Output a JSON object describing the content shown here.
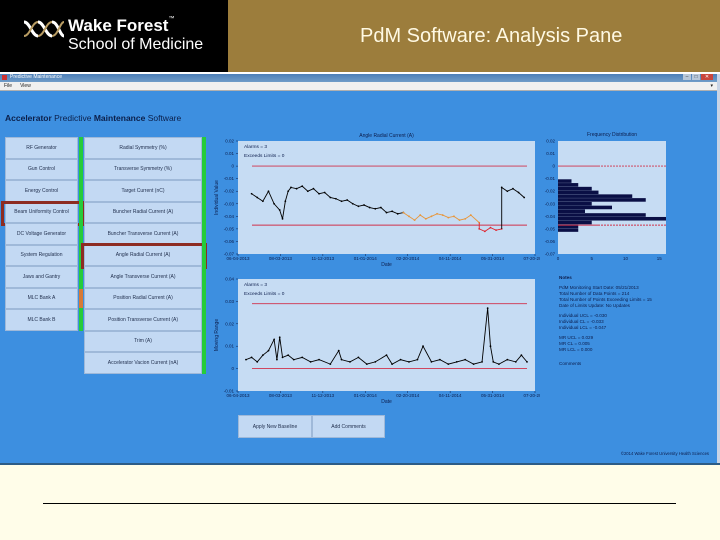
{
  "slide": {
    "logo_line1": "Wake Forest",
    "logo_tm": "™",
    "logo_line2": "School of Medicine",
    "title": "PdM Software: Analysis Pane"
  },
  "window": {
    "title": "Predictive Maintenance",
    "controls": [
      "–",
      "□",
      "✕"
    ],
    "menu": [
      "File",
      "View"
    ],
    "menu_right_icon": "dropdown-icon"
  },
  "app": {
    "heading_bold1": "Accelerator",
    "heading_normal1": " Predictive ",
    "heading_bold2": "Maintenance",
    "heading_normal2": " Software"
  },
  "systems": [
    {
      "label": "RF Generator",
      "selected": false
    },
    {
      "label": "Gun Control",
      "selected": false
    },
    {
      "label": "Energy Control",
      "selected": false
    },
    {
      "label": "Beam Uniformity Control",
      "selected": true
    },
    {
      "label": "DC Voltage Generator",
      "selected": false
    },
    {
      "label": "System Regulation",
      "selected": false
    },
    {
      "label": "Jaws and Gantry",
      "selected": false
    },
    {
      "label": "MLC Bank A",
      "selected": false
    },
    {
      "label": "MLC Bank B",
      "selected": false
    }
  ],
  "parameters": [
    {
      "label": "Radial Symmetry (%)",
      "selected": false
    },
    {
      "label": "Transverse Symmetry (%)",
      "selected": false
    },
    {
      "label": "Target Current (nC)",
      "selected": false
    },
    {
      "label": "Buncher Radial Current (A)",
      "selected": false
    },
    {
      "label": "Buncher Transverse Current (A)",
      "selected": false
    },
    {
      "label": "Angle Radial Current (A)",
      "selected": true
    },
    {
      "label": "Angle Transverse Current (A)",
      "selected": false
    },
    {
      "label": "Position Radial Current (A)",
      "selected": false
    },
    {
      "label": "Position Transverse Current (A)",
      "selected": false
    },
    {
      "label": "Trim (A)",
      "selected": false
    },
    {
      "label": "Accelerator Vacion Current (nA)",
      "selected": false
    }
  ],
  "colors": {
    "app_bg": "#3d8fe0",
    "panel_bg": "#c3d9f3",
    "status_green": "#25cc3a",
    "status_orange": "#d77a36",
    "highlight_red": "#8d2c22",
    "limit_line": "#d0304a",
    "warn_orange": "#e8963a",
    "alarm_red": "#e0202a",
    "hist_bar": "#0a0f45"
  },
  "chart_data": [
    {
      "type": "line",
      "title": "Angle Radial Current (A)",
      "xlabel": "Date",
      "ylabel": "Individual Value",
      "ylim": [
        -0.07,
        0.02
      ],
      "yticks": [
        "0.02",
        "0.01",
        "0",
        "-0.01",
        "-0.02",
        "-0.03",
        "-0.04",
        "-0.05",
        "-0.06",
        "-0.07"
      ],
      "xticks": [
        "06-04-2013",
        "08-03-2013",
        "11-12-2013",
        "01-01-2014",
        "02-20-2014",
        "04-11-2014",
        "05-31-2014",
        "07-20-2014"
      ],
      "annotations": [
        "Alarms = 3",
        "Exceeds Limits = 0"
      ],
      "limits": {
        "ucl": 0.0,
        "lcl": -0.047
      },
      "series": [
        {
          "name": "normal",
          "color": "#000000",
          "x": [
            0.02,
            0.04,
            0.06,
            0.08,
            0.1,
            0.12,
            0.13,
            0.14,
            0.15,
            0.16,
            0.18,
            0.2,
            0.22,
            0.24,
            0.26,
            0.28,
            0.3,
            0.32,
            0.34,
            0.36,
            0.38,
            0.4,
            0.42,
            0.44,
            0.46,
            0.48,
            0.5,
            0.52,
            0.54,
            0.56
          ],
          "values": [
            -0.022,
            -0.025,
            -0.028,
            -0.02,
            -0.03,
            -0.035,
            -0.042,
            -0.028,
            -0.02,
            -0.017,
            -0.018,
            -0.016,
            -0.02,
            -0.018,
            -0.022,
            -0.021,
            -0.025,
            -0.026,
            -0.028,
            -0.027,
            -0.03,
            -0.032,
            -0.031,
            -0.033,
            -0.034,
            -0.033,
            -0.037,
            -0.036,
            -0.038,
            -0.037
          ]
        },
        {
          "name": "warning",
          "color": "#e8963a",
          "x": [
            0.56,
            0.58,
            0.6,
            0.62,
            0.64,
            0.66,
            0.68,
            0.7,
            0.72,
            0.74,
            0.76,
            0.78,
            0.8,
            0.83
          ],
          "values": [
            -0.037,
            -0.04,
            -0.043,
            -0.039,
            -0.042,
            -0.04,
            -0.038,
            -0.039,
            -0.041,
            -0.04,
            -0.043,
            -0.042,
            -0.039,
            -0.045
          ]
        },
        {
          "name": "alarm",
          "color": "#e0202a",
          "x": [
            0.83,
            0.85,
            0.87,
            0.89,
            0.91
          ],
          "values": [
            -0.05,
            -0.052,
            -0.049,
            -0.051,
            -0.05
          ]
        },
        {
          "name": "recovered",
          "color": "#000000",
          "x": [
            0.91,
            0.93,
            0.95,
            0.97,
            0.99
          ],
          "values": [
            -0.017,
            -0.02,
            -0.018,
            -0.021,
            -0.025
          ]
        }
      ]
    },
    {
      "type": "bar",
      "orientation": "horizontal",
      "title": "Frequency Distribution",
      "ylim": [
        -0.07,
        0.02
      ],
      "xlim": [
        0,
        16
      ],
      "xticks": [
        "0",
        "5",
        "10",
        "15"
      ],
      "yticks": [
        "0.02",
        "0.01",
        "0",
        "-0.01",
        "-0.02",
        "-0.03",
        "-0.04",
        "-0.05",
        "-0.06",
        "-0.07"
      ],
      "bins": [
        -0.012,
        -0.015,
        -0.018,
        -0.021,
        -0.024,
        -0.027,
        -0.03,
        -0.033,
        -0.036,
        -0.039,
        -0.042,
        -0.045,
        -0.048,
        -0.051
      ],
      "values": [
        2,
        3,
        5,
        6,
        11,
        13,
        5,
        8,
        4,
        13,
        16,
        5,
        3,
        3
      ]
    },
    {
      "type": "line",
      "title": "",
      "xlabel": "Date",
      "ylabel": "Moving Range",
      "ylim": [
        -0.01,
        0.04
      ],
      "yticks": [
        "0.04",
        "0.03",
        "0.02",
        "0.01",
        "0",
        "-0.01"
      ],
      "xticks": [
        "06-04-2013",
        "08-03-2013",
        "11-12-2013",
        "01-01-2014",
        "02-20-2014",
        "04-11-2014",
        "05-31-2014",
        "07-20-2014"
      ],
      "annotations": [
        "Alarms = 3",
        "Exceeds Limits = 0"
      ],
      "limits": {
        "ucl": 0.029,
        "lcl": 0.0
      },
      "series": [
        {
          "name": "moving-range",
          "color": "#000000",
          "x": [
            0.0,
            0.02,
            0.04,
            0.06,
            0.08,
            0.1,
            0.11,
            0.12,
            0.13,
            0.15,
            0.17,
            0.2,
            0.23,
            0.26,
            0.3,
            0.33,
            0.34,
            0.37,
            0.4,
            0.43,
            0.46,
            0.5,
            0.52,
            0.55,
            0.58,
            0.61,
            0.63,
            0.66,
            0.69,
            0.72,
            0.75,
            0.78,
            0.81,
            0.84,
            0.86,
            0.87,
            0.88,
            0.9,
            0.93,
            0.96,
            0.98,
            1.0
          ],
          "values": [
            0.004,
            0.005,
            0.003,
            0.006,
            0.008,
            0.013,
            0.004,
            0.014,
            0.005,
            0.006,
            0.004,
            0.005,
            0.003,
            0.004,
            0.002,
            0.008,
            0.004,
            0.003,
            0.005,
            0.002,
            0.003,
            0.006,
            0.002,
            0.004,
            0.003,
            0.004,
            0.01,
            0.003,
            0.004,
            0.002,
            0.003,
            0.004,
            0.002,
            0.003,
            0.027,
            0.01,
            0.003,
            0.002,
            0.004,
            0.003,
            0.006,
            0.003
          ]
        }
      ]
    }
  ],
  "notes": {
    "heading": "Notes",
    "lines": [
      "PdM Monitoring Start Date: 05/21/2013",
      "Total Number of Data Points = 214",
      "Total Number of Points Exceeding Limits = 15",
      "Date of Limits Update: No Updates"
    ],
    "individual": [
      "Individual UCL = -0.030",
      "Individual CL = -0.033",
      "Individual LCL = -0.047"
    ],
    "mr": [
      "MR UCL = 0.029",
      "MR CL = 0.005",
      "MR LCL = 0.000"
    ],
    "comments_label": "Comments"
  },
  "actions": {
    "apply_baseline": "Apply New Baseline",
    "add_comments": "Add Comments"
  },
  "copyright": "©2014 Wake Forest University Health Sciences"
}
